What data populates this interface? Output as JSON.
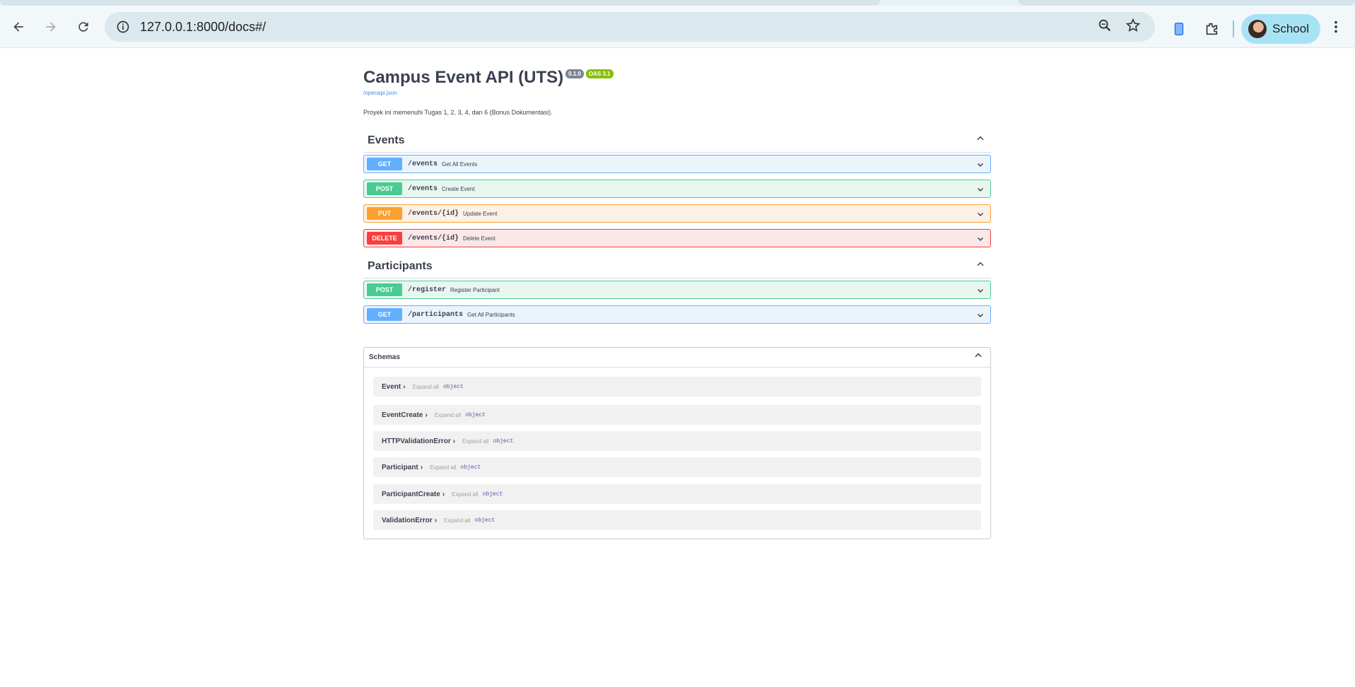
{
  "browser": {
    "url": "127.0.0.1:8000/docs#/",
    "profile_name": "School"
  },
  "header": {
    "title": "Campus Event API (UTS)",
    "version_badge": "0.1.0",
    "oas_badge": "OAS 3.1",
    "openapi_link": "/openapi.json",
    "description": "Proyek ini memenuhi Tugas 1, 2, 3, 4, dan 6 (Bonus Dokumentasi)."
  },
  "tags": [
    {
      "name": "Events",
      "operations": [
        {
          "method": "GET",
          "path": "/events",
          "summary": "Get All Events"
        },
        {
          "method": "POST",
          "path": "/events",
          "summary": "Create Event"
        },
        {
          "method": "PUT",
          "path": "/events/{id}",
          "summary": "Update Event"
        },
        {
          "method": "DELETE",
          "path": "/events/{id}",
          "summary": "Delete Event"
        }
      ]
    },
    {
      "name": "Participants",
      "operations": [
        {
          "method": "POST",
          "path": "/register",
          "summary": "Register Participant"
        },
        {
          "method": "GET",
          "path": "/participants",
          "summary": "Get All Participants"
        }
      ]
    }
  ],
  "schemas": {
    "title": "Schemas",
    "expand_label": "Expand all",
    "type_label": "object",
    "models": [
      "Event",
      "EventCreate",
      "HTTPValidationError",
      "Participant",
      "ParticipantCreate",
      "ValidationError"
    ]
  },
  "colors": {
    "get": "#61affe",
    "post": "#49cc90",
    "put": "#fca130",
    "delete": "#f93e3e"
  }
}
